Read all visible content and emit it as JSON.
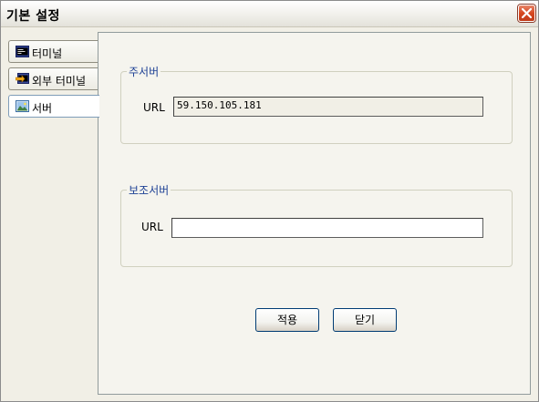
{
  "window": {
    "title": "기본 설정"
  },
  "icons": {
    "close": "close-x-icon",
    "terminal": "terminal-icon",
    "external_terminal": "external-terminal-icon",
    "server": "server-image-icon"
  },
  "tabs": [
    {
      "label": "터미널",
      "active": false
    },
    {
      "label": "외부 터미널",
      "active": false
    },
    {
      "label": "서버",
      "active": true
    }
  ],
  "main_server": {
    "legend": "주서버",
    "url_label": "URL",
    "url_value": "59.150.105.181"
  },
  "backup_server": {
    "legend": "보조서버",
    "url_label": "URL",
    "url_value": ""
  },
  "buttons": {
    "apply": "적용",
    "close": "닫기"
  },
  "colors": {
    "legend_text": "#1c3f94",
    "close_button": "#d6471f",
    "active_tab_border": "#7f9db9"
  }
}
